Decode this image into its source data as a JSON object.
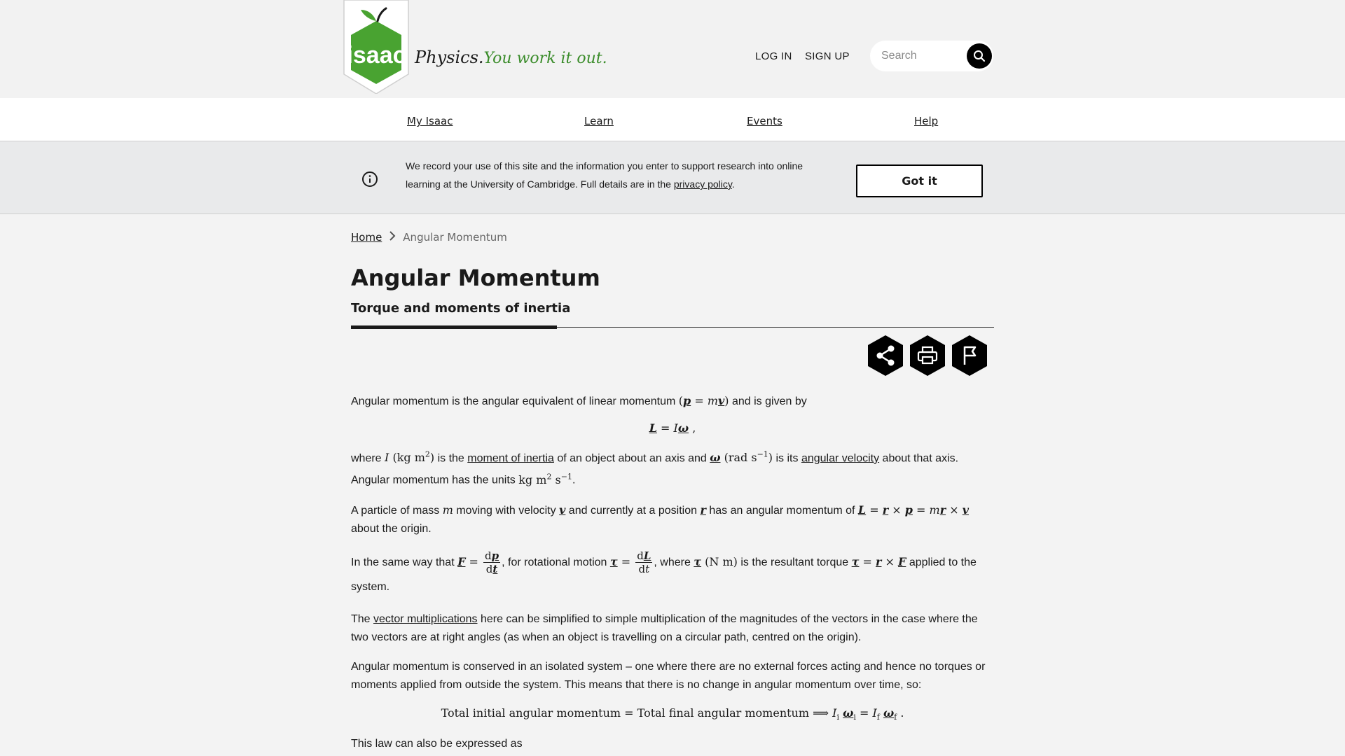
{
  "header": {
    "logo_text": "isaac",
    "tagline_part1": "Physics.",
    "tagline_part2": "You work it out.",
    "login_label": "LOG IN",
    "signup_label": "SIGN UP",
    "search_placeholder": "Search",
    "search_icon": "search-icon"
  },
  "nav": {
    "items": [
      {
        "label": "My Isaac"
      },
      {
        "label": "Learn"
      },
      {
        "label": "Events"
      },
      {
        "label": "Help"
      }
    ]
  },
  "cookie": {
    "text_before": "We record your use of this site and the information you enter to support research into online learning at the University of Cambridge. Full details are in the ",
    "link_label": "privacy policy",
    "text_after": ".",
    "button_label": "Got it",
    "icon": "info-icon"
  },
  "breadcrumb": {
    "home_label": "Home",
    "current_label": "Angular Momentum"
  },
  "page": {
    "title": "Angular Momentum",
    "subtitle": "Torque and moments of inertia",
    "actions": [
      {
        "icon": "share-icon"
      },
      {
        "icon": "print-icon"
      },
      {
        "icon": "flag-icon"
      }
    ]
  },
  "content": {
    "p1_a": "Angular momentum is the angular equivalent of linear momentum ",
    "p1_b": " and is given by",
    "p2_a": "where ",
    "p2_b": " is the ",
    "p2_link1": "moment of inertia",
    "p2_c": " of an object about an axis and ",
    "p2_d": " is its ",
    "p2_link2": "angular velocity",
    "p2_e": " about that axis. Angular momentum has the units ",
    "p3_a": "A particle of mass ",
    "p3_b": " moving with velocity ",
    "p3_c": " and currently at a position ",
    "p3_d": " has an angular momentum of ",
    "p3_e": " about the origin.",
    "p4_a": "In the same way that ",
    "p4_b": ", for rotational motion ",
    "p4_c": ", where ",
    "p4_d": " is the resultant torque ",
    "p4_e": " applied to the system.",
    "p5_a": "The ",
    "p5_link": "vector multiplications",
    "p5_b": " here can be simplified to simple multiplication of the magnitudes of the vectors in the case where the two vectors are at right angles (as when an object is travelling on a circular path, centred on the origin).",
    "p6": "Angular momentum is conserved in an isolated system – one where there are no external forces acting and hence no torques or moments applied from outside the system. This means that there is no change in angular momentum over time, so:",
    "eq2_text_a": "Total initial angular momentum",
    "eq2_text_b": "Total final angular momentum",
    "p7": "This law can also be expressed as"
  },
  "colors": {
    "brand_green": "#3a8c2a",
    "logo_green": "#49a331",
    "page_bg": "#f3f3f3",
    "cookie_bg": "#e9eaeb"
  }
}
